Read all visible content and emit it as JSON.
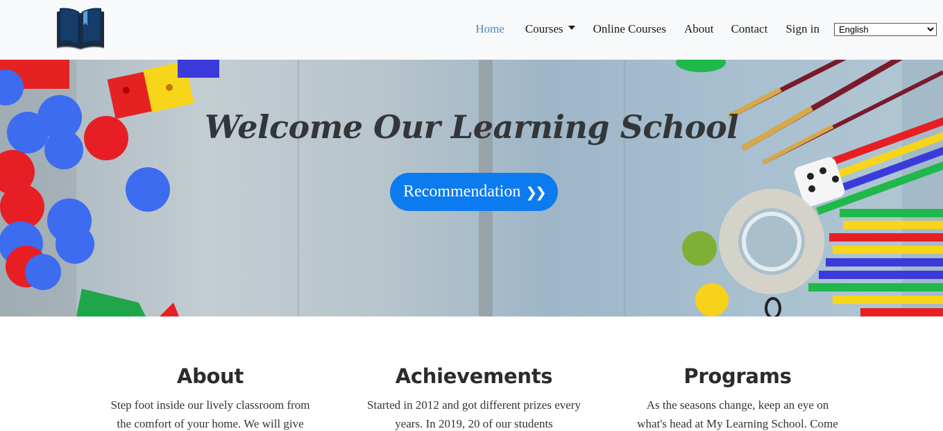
{
  "nav": {
    "logo": "book-logo",
    "links": [
      {
        "label": "Home",
        "active": true
      },
      {
        "label": "Courses",
        "dropdown": true
      },
      {
        "label": "Online Courses"
      },
      {
        "label": "About"
      },
      {
        "label": "Contact"
      },
      {
        "label": "Sign in"
      }
    ],
    "language": {
      "selected": "English"
    }
  },
  "hero": {
    "title": "Welcome Our Learning School",
    "button_label": "Recommendation",
    "button_icon": "double-chevron-right-icon",
    "colors": {
      "button": "#0d7bf0"
    }
  },
  "sections": [
    {
      "title": "About",
      "text": "Step foot inside our lively classroom from the comfort of your home. We will give"
    },
    {
      "title": "Achievements",
      "text": "Started in 2012 and got different prizes every years. In 2019, 20 of our students"
    },
    {
      "title": "Programs",
      "text": "As the seasons change, keep an eye on what's head at My Learning School. Come"
    }
  ],
  "colors": {
    "navbar_bg": "#f8f9fa",
    "active_link": "#4a8ac4"
  }
}
